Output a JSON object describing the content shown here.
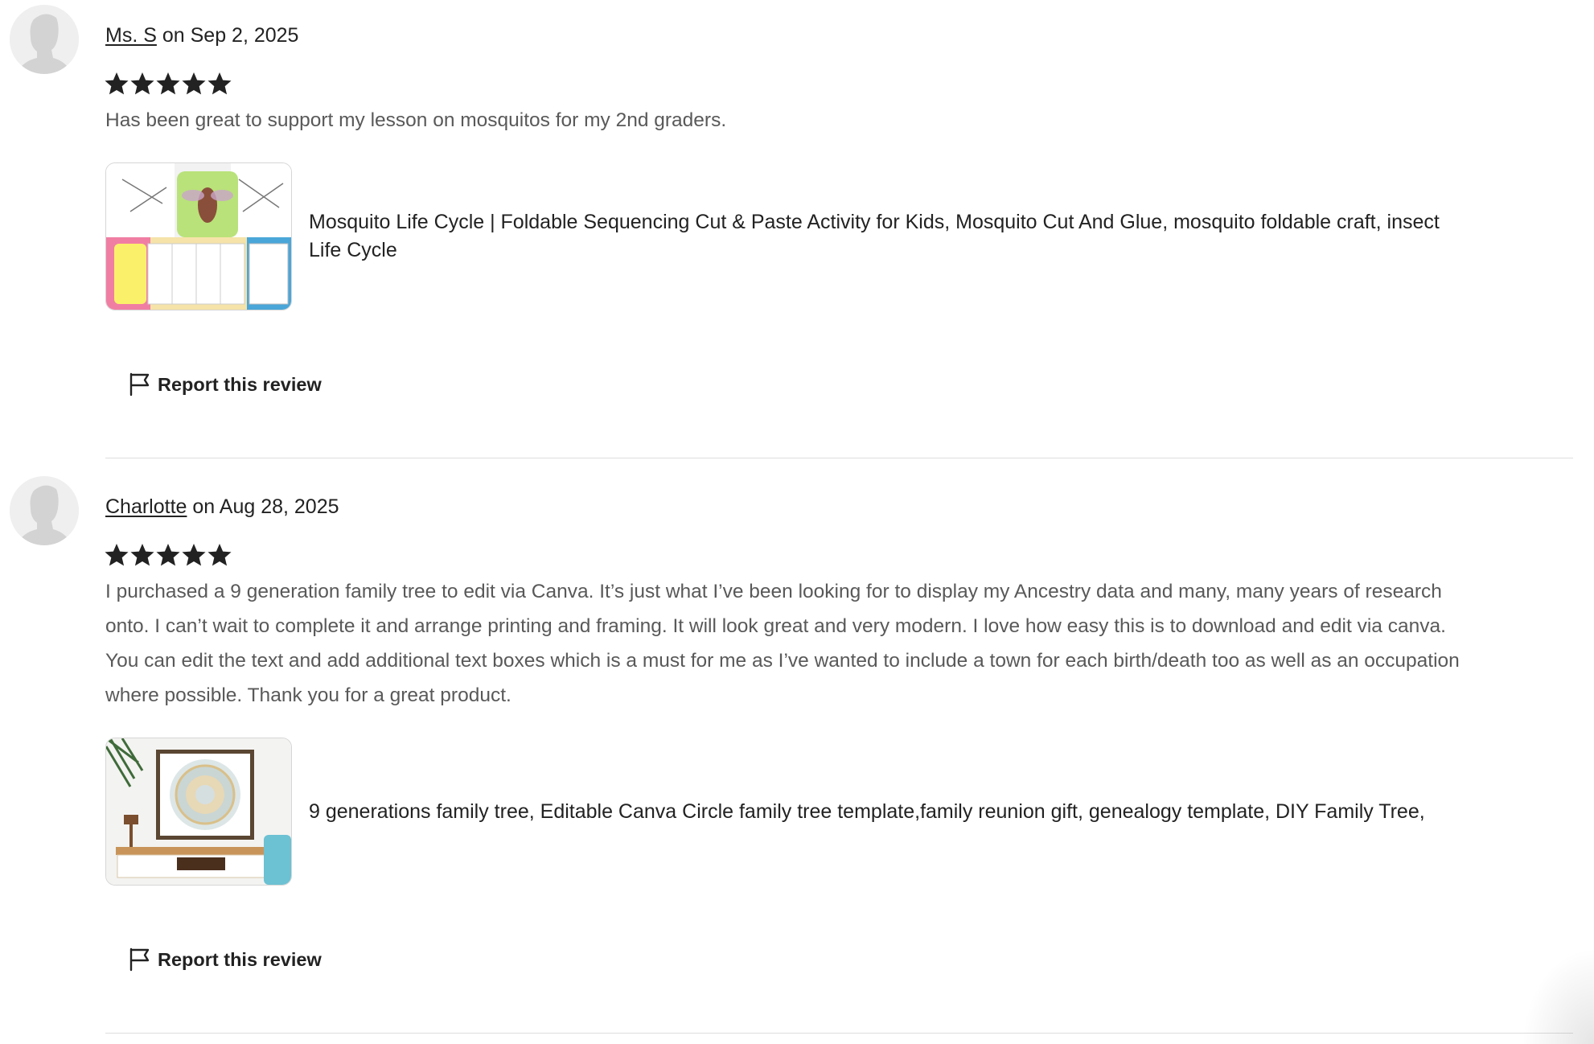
{
  "reviews": [
    {
      "reviewer": "Ms. S",
      "date_text": "on Sep 2, 2025",
      "rating": 5,
      "text": "Has been great to support my lesson on mosquitos for my 2nd graders.",
      "product_title": "Mosquito Life Cycle | Foldable Sequencing Cut & Paste Activity for Kids, Mosquito Cut And Glue, mosquito foldable craft, insect Life Cycle",
      "report_label": "Report this review"
    },
    {
      "reviewer": "Charlotte",
      "date_text": "on Aug 28, 2025",
      "rating": 5,
      "text": "I purchased a 9 generation family tree to edit via Canva. It’s just what I’ve been looking for to display my Ancestry data and many, many years of research onto. I can’t wait to complete it and arrange printing and framing. It will look great and very modern. I love how easy this is to download and edit via canva. You can edit the text and add additional text boxes which is a must for me as I’ve wanted to include a town for each birth/death too as well as an occupation where possible. Thank you for a great product.",
      "product_title": "9 generations family tree, Editable Canva Circle family tree template,family reunion gift, genealogy template, DIY Family Tree,",
      "report_label": "Report this review"
    }
  ],
  "icons": {
    "avatar": "avatar-placeholder-icon",
    "star": "star-icon",
    "flag": "flag-icon"
  },
  "colors": {
    "text_primary": "#222222",
    "text_secondary": "#595959",
    "divider": "#dddddd",
    "avatar_bg": "#efefef"
  }
}
